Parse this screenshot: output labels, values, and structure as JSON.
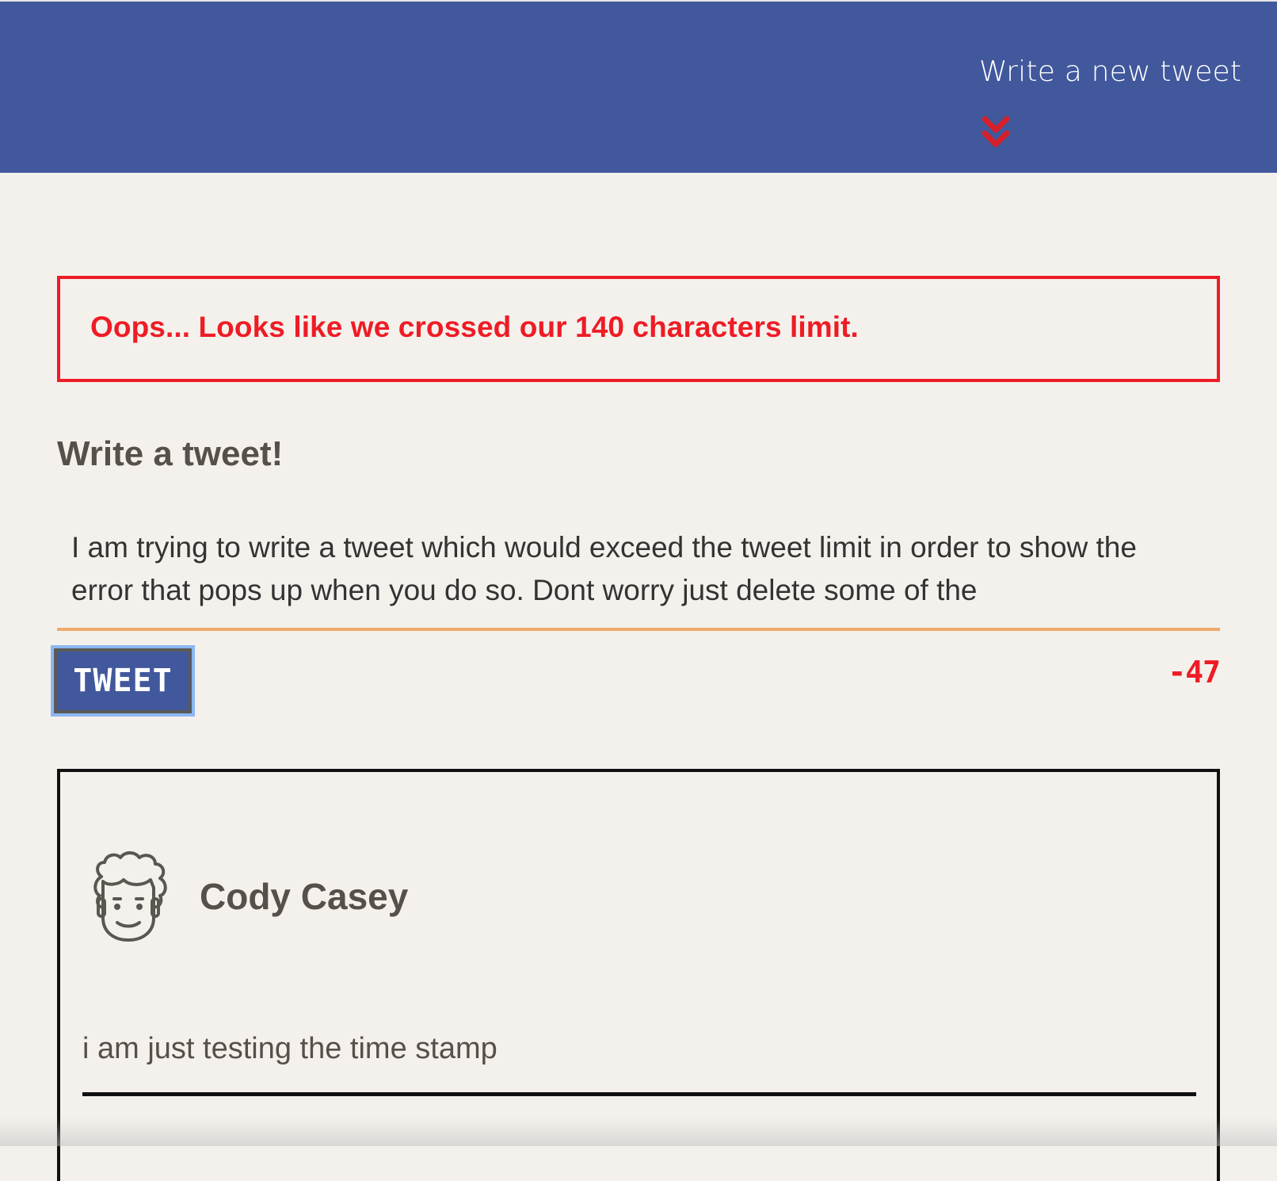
{
  "nav": {
    "compose_label": "Write a new tweet",
    "compose_icon": "double-chevron-down-icon",
    "background_color": "#42589c",
    "arrow_color": "#d4202a"
  },
  "error": {
    "message": "Oops... Looks like we crossed our 140 characters limit.",
    "color": "#ee1c25"
  },
  "compose": {
    "title": "Write a tweet!",
    "text": "I am trying to write a tweet which would exceed the tweet limit in order to show the error that pops up when you do so. Dont worry just delete some of the",
    "button_label": "TWEET",
    "counter": "-47",
    "underline_color": "#eeaa6c"
  },
  "tweets": [
    {
      "author": "Cody Casey",
      "avatar_icon": "curly-hair-face-avatar-icon",
      "content": "i am just testing the time stamp"
    }
  ]
}
